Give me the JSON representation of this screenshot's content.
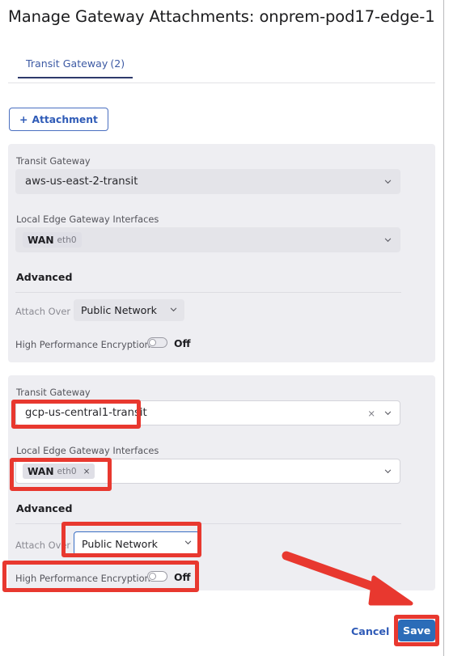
{
  "header": {
    "title": "Manage Gateway Attachments: onprem-pod17-edge-1"
  },
  "tabs": [
    {
      "label": "Transit Gateway",
      "count": "(2)",
      "active": true
    }
  ],
  "toolbar": {
    "add_attachment_plus": "+",
    "add_attachment_label": "Attachment"
  },
  "attachments": [
    {
      "id": "attachment-1",
      "disabled": true,
      "transit_gateway_label": "Transit Gateway",
      "transit_gateway_value": "aws-us-east-2-transit",
      "interfaces_label": "Local Edge Gateway Interfaces",
      "interface_chip_main": "WAN",
      "interface_chip_sub": "eth0",
      "advanced_label": "Advanced",
      "attach_over_label": "Attach Over",
      "attach_over_value": "Public Network",
      "hpe_label": "High Performance Encryption",
      "hpe_state": "Off"
    },
    {
      "id": "attachment-2",
      "disabled": false,
      "transit_gateway_label": "Transit Gateway",
      "transit_gateway_value": "gcp-us-central1-transit",
      "clear_icon": "×",
      "interfaces_label": "Local Edge Gateway Interfaces",
      "interface_chip_main": "WAN",
      "interface_chip_sub": "eth0",
      "interface_chip_remove": "×",
      "advanced_label": "Advanced",
      "attach_over_label": "Attach Over",
      "attach_over_value": "Public Network",
      "hpe_label": "High Performance Encryption",
      "hpe_state": "Off"
    }
  ],
  "footer": {
    "cancel_label": "Cancel",
    "save_label": "Save"
  },
  "icons": {
    "chevron_down": "⌄"
  },
  "colors": {
    "annotation_red": "#e8382f",
    "primary_blue": "#2b6cb8",
    "link_blue": "#2f5bb7",
    "tab_underline": "#2e3a6b",
    "panel_bg": "#eeeef2",
    "disabled_control_bg": "#e4e4e9"
  }
}
